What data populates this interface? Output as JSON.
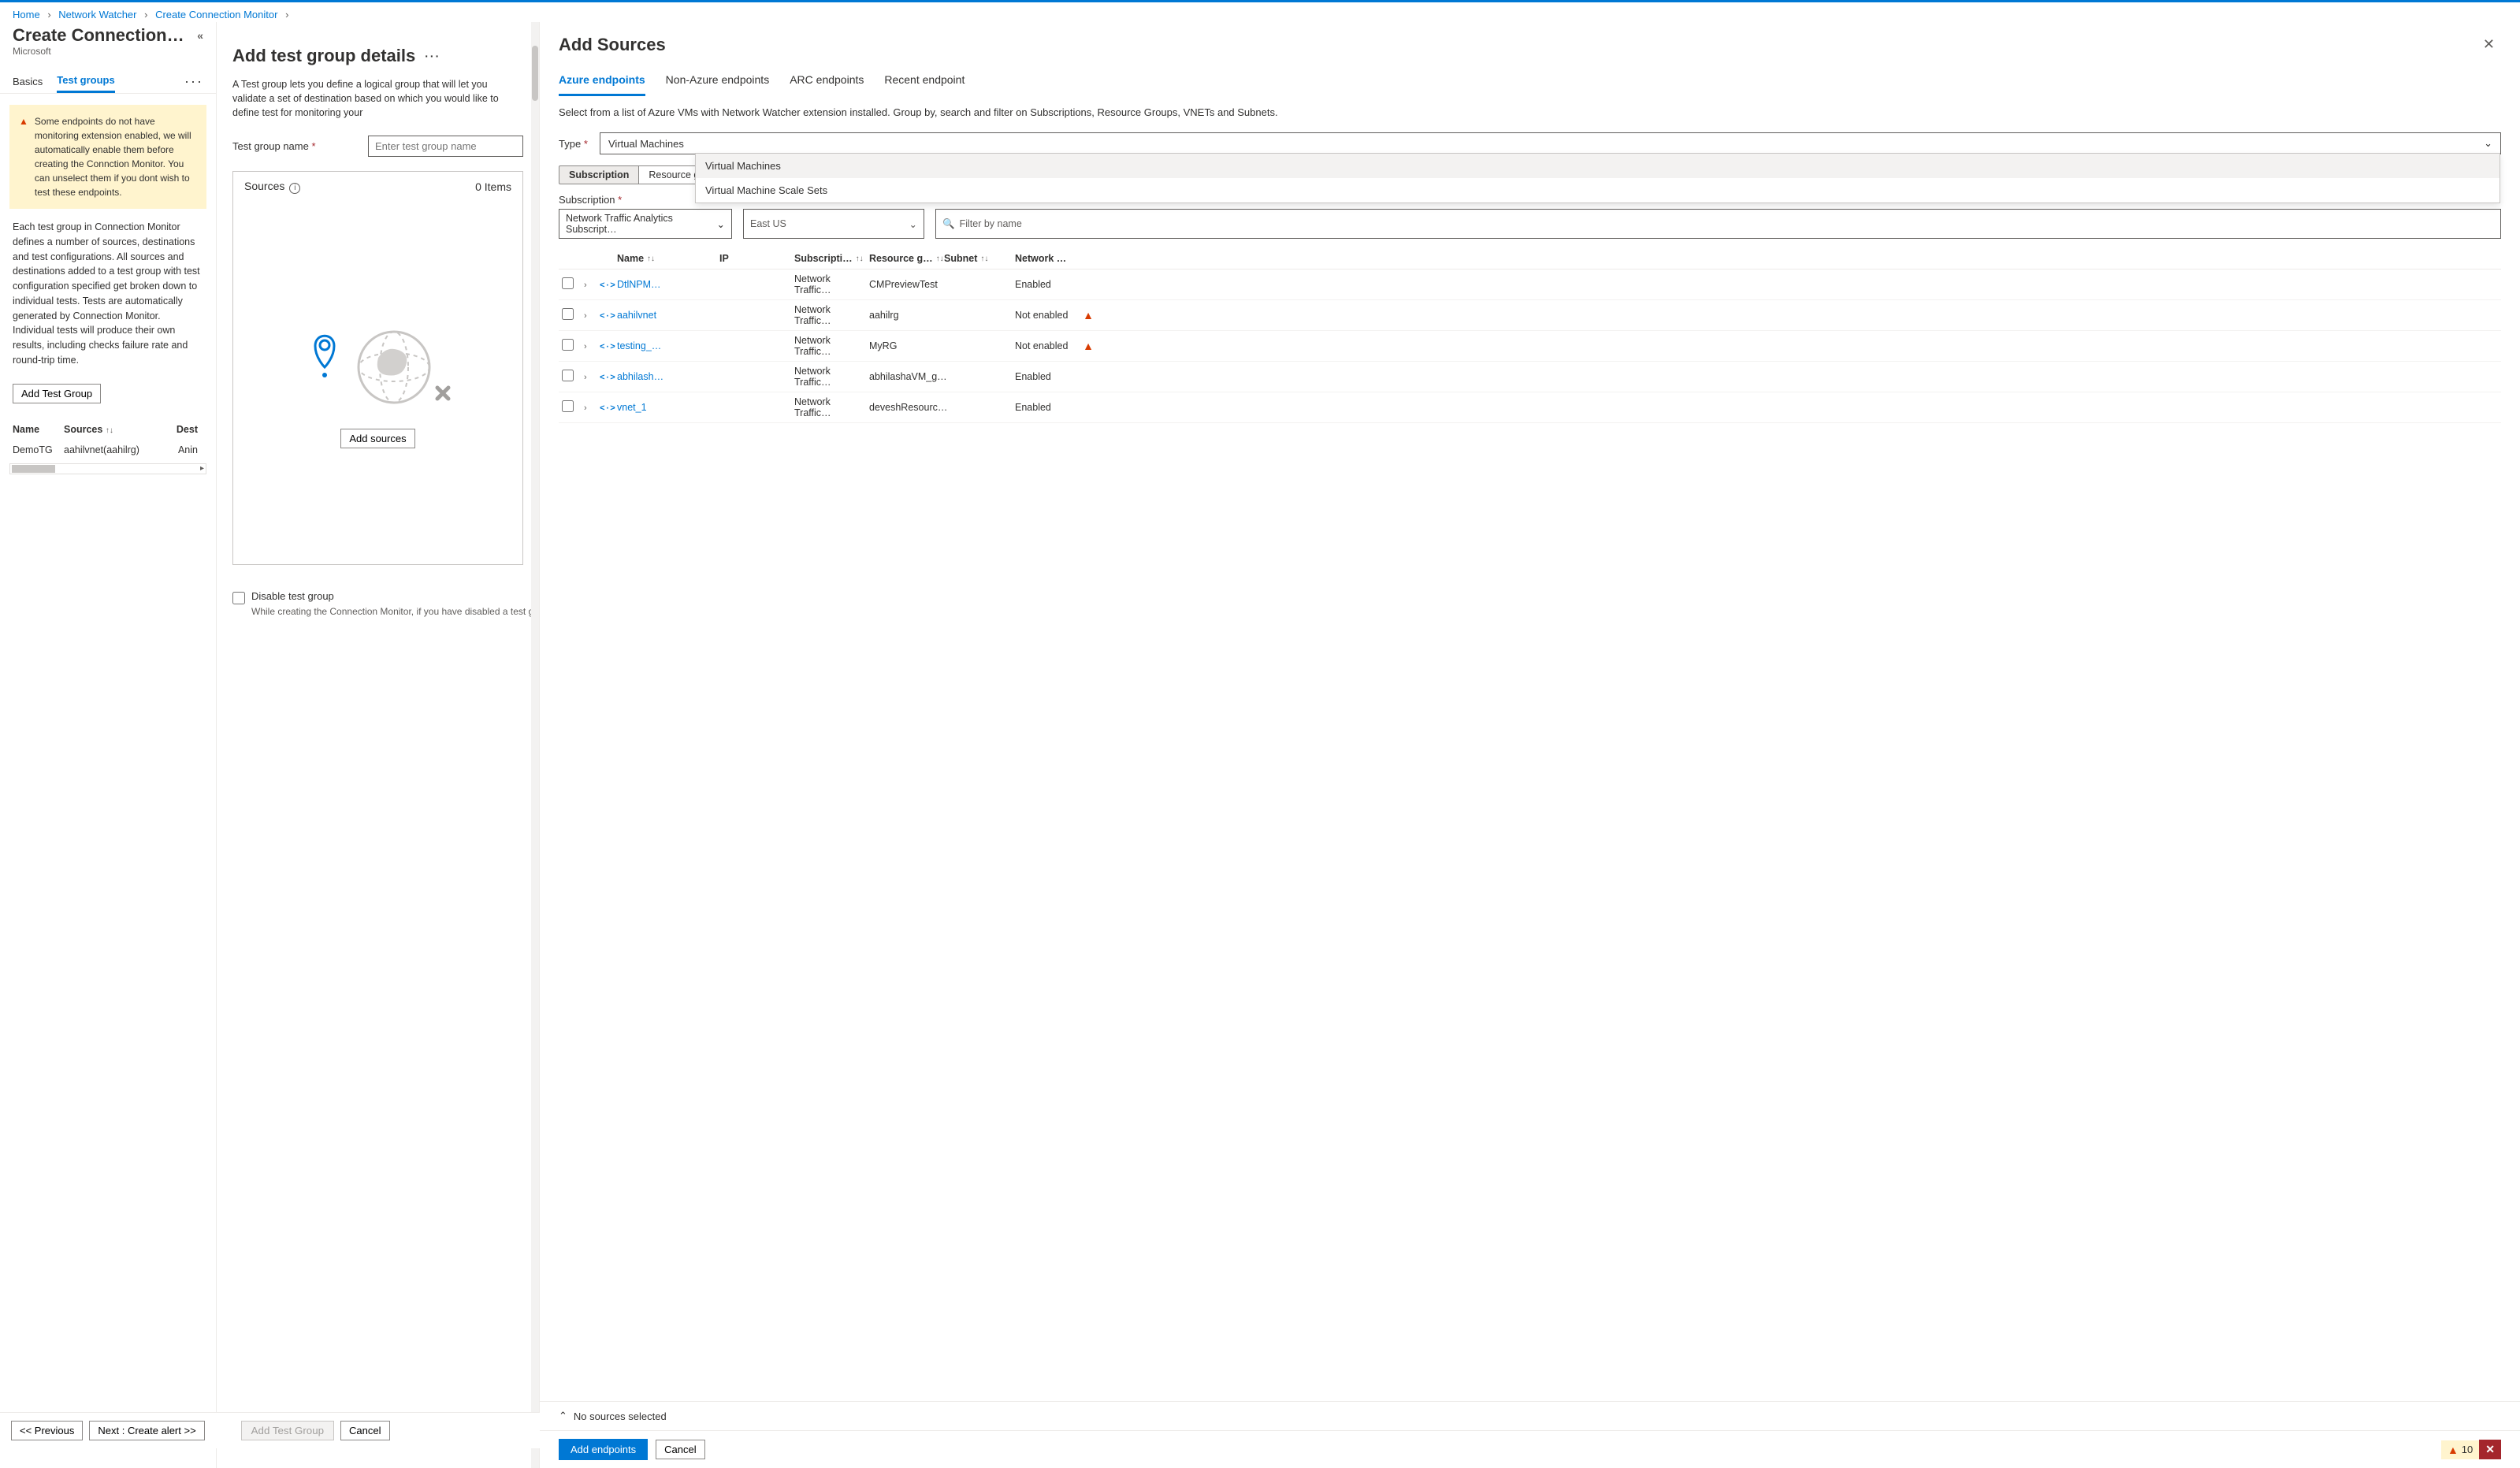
{
  "breadcrumbs": [
    "Home",
    "Network Watcher",
    "Create Connection Monitor"
  ],
  "left": {
    "title": "Create Connection…",
    "subtitle": "Microsoft",
    "tabs": {
      "basics": "Basics",
      "testgroups": "Test groups"
    },
    "warning": "Some endpoints do not have monitoring extension enabled, we will automatically enable them before creating the Connction Monitor. You can unselect them if you dont wish to test these endpoints.",
    "description": "Each test group in Connection Monitor defines a number of sources, destinations and test configurations. All sources and destinations added to a test group with test configuration specified get broken down to individual tests. Tests are automatically generated by Connection Monitor. Individual tests will produce their own results, including checks failure rate and round-trip time.",
    "add_btn": "Add Test Group",
    "table_head": {
      "name": "Name",
      "sources": "Sources",
      "dest": "Dest"
    },
    "row": {
      "name": "DemoTG",
      "sources": "aahilvnet(aahilrg)",
      "dest": "Anin"
    }
  },
  "mid": {
    "title": "Add test group details",
    "description": "A Test group lets you define a logical group that will let you validate a set of destination based on which you would like to define test for monitoring your",
    "group_name_label": "Test group name",
    "group_name_placeholder": "Enter test group name",
    "sources_label": "Sources",
    "sources_count": "0 Items",
    "add_sources_btn": "Add sources",
    "disable_label": "Disable test group",
    "disable_hint": "While creating the Connection Monitor, if you have disabled a test gr"
  },
  "right": {
    "title": "Add Sources",
    "tabs": [
      "Azure endpoints",
      "Non-Azure endpoints",
      "ARC endpoints",
      "Recent endpoint"
    ],
    "description": "Select from a list of Azure VMs with Network Watcher extension installed. Group by, search and filter on Subscriptions, Resource Groups, VNETs and Subnets.",
    "type_label": "Type",
    "type_value": "Virtual Machines",
    "type_options": [
      "Virtual Machines",
      "Virtual Machine Scale Sets"
    ],
    "pills": [
      "Subscription",
      "Resource grou"
    ],
    "subscription_label": "Subscription",
    "subscription_value": "Network Traffic Analytics Subscript…",
    "region_value": "East US",
    "filter_placeholder": "Filter by name",
    "grid_head": {
      "name": "Name",
      "ip": "IP",
      "sub": "Subscripti…",
      "rg": "Resource g…",
      "subnet": "Subnet",
      "nwe": "Network …"
    },
    "rows": [
      {
        "name": "DtlNPM…",
        "sub": "Network Traffic…",
        "rg": "CMPreviewTest",
        "nwe": "Enabled",
        "warn": false
      },
      {
        "name": "aahilvnet",
        "sub": "Network Traffic…",
        "rg": "aahilrg",
        "nwe": "Not enabled",
        "warn": true
      },
      {
        "name": "testing_…",
        "sub": "Network Traffic…",
        "rg": "MyRG",
        "nwe": "Not enabled",
        "warn": true
      },
      {
        "name": "abhilash…",
        "sub": "Network Traffic…",
        "rg": "abhilashaVM_g…",
        "nwe": "Enabled",
        "warn": false
      },
      {
        "name": "vnet_1",
        "sub": "Network Traffic…",
        "rg": "deveshResourc…",
        "nwe": "Enabled",
        "warn": false
      }
    ],
    "selected_text": "No sources selected",
    "add_endpoints_btn": "Add endpoints",
    "cancel_btn": "Cancel"
  },
  "footer": {
    "prev": "<<  Previous",
    "next": "Next : Create alert  >>",
    "add_tg": "Add Test Group",
    "cancel": "Cancel",
    "warn_count": "10"
  }
}
